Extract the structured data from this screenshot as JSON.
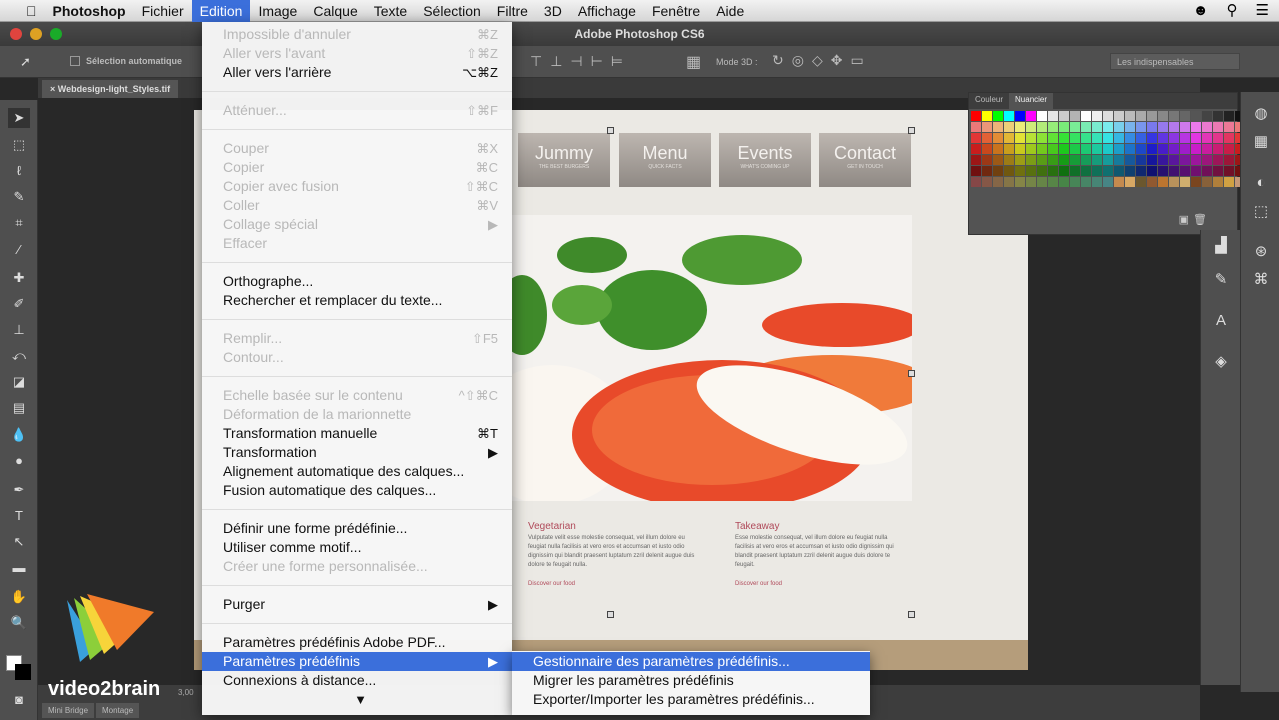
{
  "menubar": {
    "items": [
      "Photoshop",
      "Fichier",
      "Edition",
      "Image",
      "Calque",
      "Texte",
      "Sélection",
      "Filtre",
      "3D",
      "Affichage",
      "Fenêtre",
      "Aide"
    ],
    "active": "Edition"
  },
  "window": {
    "title": "Adobe Photoshop CS6"
  },
  "options": {
    "auto_select": "Sélection automatique",
    "mode3d": "Mode 3D :",
    "workspace": "Les indispensables"
  },
  "document": {
    "tab": "Webdesign-light_Styles.tif"
  },
  "site": {
    "nav": [
      {
        "title": "Jummy",
        "sub": "THE BEST BURGERS"
      },
      {
        "title": "Menu",
        "sub": "QUICK FACTS"
      },
      {
        "title": "Events",
        "sub": "WHAT'S COMING UP"
      },
      {
        "title": "Contact",
        "sub": "GET IN TOUCH"
      }
    ],
    "columns": [
      {
        "heading": "Vegetarian",
        "body": "Vulputate velit esse molestie consequat, vel illum dolore eu feugiat nulla facilisis at vero eros et accumsan et iusto odio dignissim qui blandit praesent luptatum zzril delenit augue duis dolore te feugait nulla.",
        "link": "Discover our food"
      },
      {
        "heading": "Takeaway",
        "body": "Esse molestie consequat, vel illum dolore eu feugiat nulla facilisis at vero eros et accumsan et iusto odio dignissim qui blandit praesent luptatum zzril delenit augue duis dolore te feugait.",
        "link": "Discover our food"
      }
    ]
  },
  "swatches": {
    "tabs": [
      "Couleur",
      "Nuancier"
    ],
    "active_tab": "Nuancier"
  },
  "edit_menu": [
    {
      "label": "Impossible d'annuler",
      "shortcut": "⌘Z",
      "disabled": true
    },
    {
      "label": "Aller vers l'avant",
      "shortcut": "⇧⌘Z",
      "disabled": true
    },
    {
      "label": "Aller vers l'arrière",
      "shortcut": "⌥⌘Z"
    },
    {
      "sep": true
    },
    {
      "label": "Atténuer...",
      "shortcut": "⇧⌘F",
      "disabled": true
    },
    {
      "sep": true
    },
    {
      "label": "Couper",
      "shortcut": "⌘X",
      "disabled": true
    },
    {
      "label": "Copier",
      "shortcut": "⌘C",
      "disabled": true
    },
    {
      "label": "Copier avec fusion",
      "shortcut": "⇧⌘C",
      "disabled": true
    },
    {
      "label": "Coller",
      "shortcut": "⌘V",
      "disabled": true
    },
    {
      "label": "Collage spécial",
      "shortcut": "▶",
      "disabled": true
    },
    {
      "label": "Effacer",
      "disabled": true
    },
    {
      "sep": true
    },
    {
      "label": "Orthographe..."
    },
    {
      "label": "Rechercher et remplacer du texte..."
    },
    {
      "sep": true
    },
    {
      "label": "Remplir...",
      "shortcut": "⇧F5",
      "disabled": true
    },
    {
      "label": "Contour...",
      "disabled": true
    },
    {
      "sep": true
    },
    {
      "label": "Echelle basée sur le contenu",
      "shortcut": "^⇧⌘C",
      "disabled": true
    },
    {
      "label": "Déformation de la marionnette",
      "disabled": true
    },
    {
      "label": "Transformation manuelle",
      "shortcut": "⌘T"
    },
    {
      "label": "Transformation",
      "shortcut": "▶"
    },
    {
      "label": "Alignement automatique des calques..."
    },
    {
      "label": "Fusion automatique des calques..."
    },
    {
      "sep": true
    },
    {
      "label": "Définir une forme prédéfinie..."
    },
    {
      "label": "Utiliser comme motif..."
    },
    {
      "label": "Créer une forme personnalisée...",
      "disabled": true
    },
    {
      "sep": true
    },
    {
      "label": "Purger",
      "shortcut": "▶"
    },
    {
      "sep": true
    },
    {
      "label": "Paramètres prédéfinis Adobe PDF..."
    },
    {
      "label": "Paramètres prédéfinis",
      "shortcut": "▶",
      "highlighted": true
    },
    {
      "label": "Connexions à distance..."
    },
    {
      "label": "",
      "shortcut": "▼"
    }
  ],
  "submenu": [
    {
      "label": "Gestionnaire des paramètres prédéfinis...",
      "highlighted": true
    },
    {
      "label": "Migrer les paramètres prédéfinis"
    },
    {
      "label": "Exporter/Importer les paramètres prédéfinis..."
    }
  ],
  "bottom": {
    "tabs": [
      "Mini Bridge",
      "Montage"
    ],
    "zoom": "3,00"
  },
  "logo": {
    "text": "video2brain"
  },
  "colors": {
    "accent": "#3b6fdb"
  }
}
